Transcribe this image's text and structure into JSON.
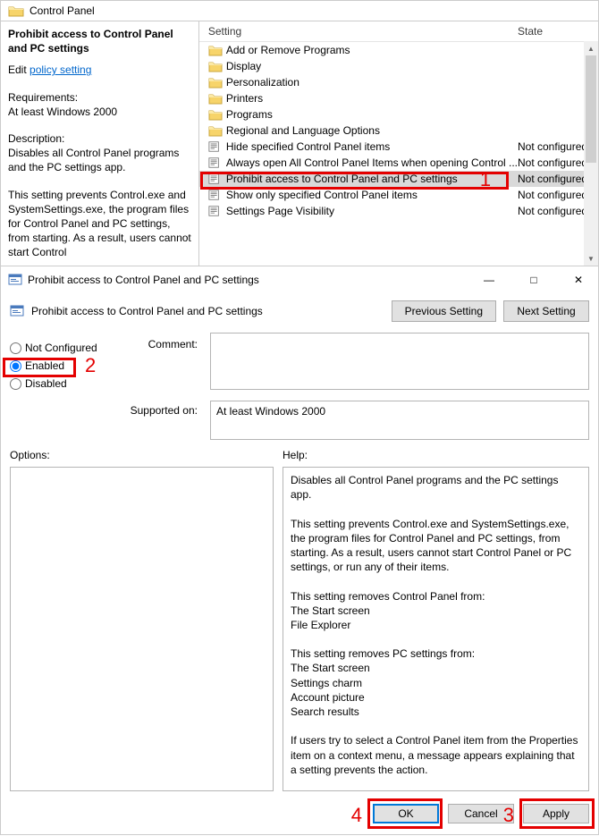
{
  "top": {
    "header_title": "Control Panel",
    "side": {
      "title": "Prohibit access to Control Panel and PC settings",
      "edit_prefix": "Edit ",
      "edit_link": "policy setting ",
      "req_label": "Requirements:",
      "req_value": "At least Windows 2000",
      "desc_label": "Description:",
      "desc_value": "Disables all Control Panel programs and the PC settings app.",
      "para2": "This setting prevents Control.exe and SystemSettings.exe, the program files for Control Panel and PC settings, from starting. As a result, users cannot start Control"
    },
    "columns": {
      "setting": "Setting",
      "state": "State"
    },
    "rows": [
      {
        "type": "folder",
        "label": "Add or Remove Programs",
        "state": ""
      },
      {
        "type": "folder",
        "label": "Display",
        "state": ""
      },
      {
        "type": "folder",
        "label": "Personalization",
        "state": ""
      },
      {
        "type": "folder",
        "label": "Printers",
        "state": ""
      },
      {
        "type": "folder",
        "label": "Programs",
        "state": ""
      },
      {
        "type": "folder",
        "label": "Regional and Language Options",
        "state": ""
      },
      {
        "type": "setting",
        "label": "Hide specified Control Panel items",
        "state": "Not configured"
      },
      {
        "type": "setting",
        "label": "Always open All Control Panel Items when opening Control ...",
        "state": "Not configured"
      },
      {
        "type": "setting",
        "label": "Prohibit access to Control Panel and PC settings",
        "state": "Not configured",
        "selected": true
      },
      {
        "type": "setting",
        "label": "Show only specified Control Panel items",
        "state": "Not configured"
      },
      {
        "type": "setting",
        "label": "Settings Page Visibility",
        "state": "Not configured"
      }
    ]
  },
  "dlg": {
    "title": "Prohibit access to Control Panel and PC settings",
    "subtitle": "Prohibit access to Control Panel and PC settings",
    "prev_btn": "Previous Setting",
    "next_btn": "Next Setting",
    "radio_not": "Not Configured",
    "radio_en": "Enabled",
    "radio_dis": "Disabled",
    "comment_label": "Comment:",
    "supported_label": "Supported on:",
    "supported_value": "At least Windows 2000",
    "options_label": "Options:",
    "help_label": "Help:",
    "help_text": "Disables all Control Panel programs and the PC settings app.\n\nThis setting prevents Control.exe and SystemSettings.exe, the program files for Control Panel and PC settings, from starting. As a result, users cannot start Control Panel or PC settings, or run any of their items.\n\nThis setting removes Control Panel from:\nThe Start screen\nFile Explorer\n\nThis setting removes PC settings from:\nThe Start screen\nSettings charm\nAccount picture\nSearch results\n\nIf users try to select a Control Panel item from the Properties item on a context menu, a message appears explaining that a setting prevents the action.",
    "ok": "OK",
    "cancel": "Cancel",
    "apply": "Apply"
  },
  "ann": {
    "n1": "1",
    "n2": "2",
    "n3": "3",
    "n4": "4"
  }
}
